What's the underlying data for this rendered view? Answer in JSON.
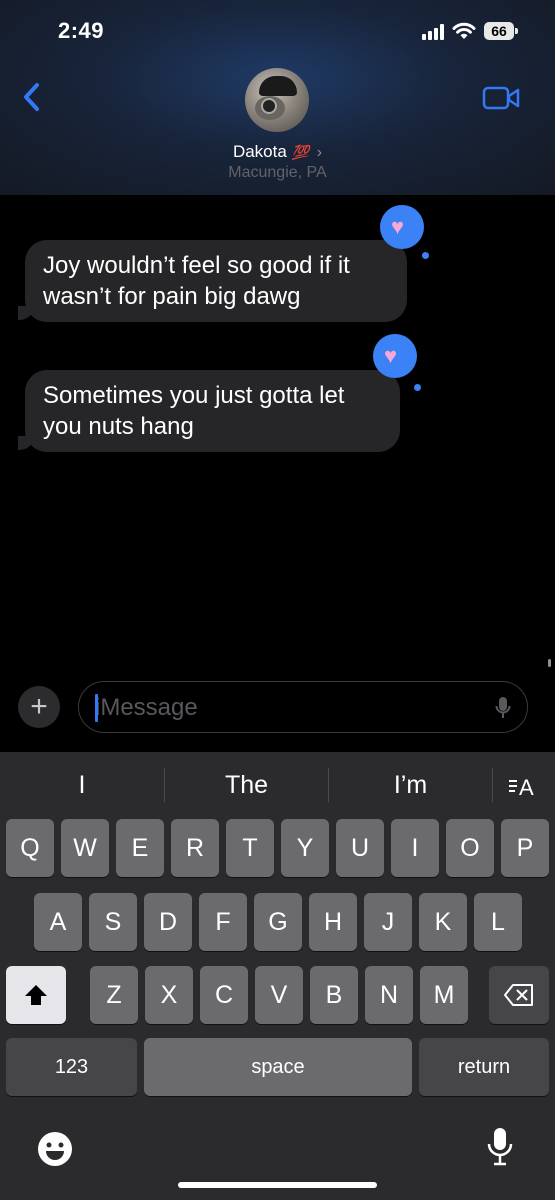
{
  "status": {
    "time": "2:49",
    "battery": "66"
  },
  "contact": {
    "name": "Dakota",
    "emoji": "💯",
    "location": "Macungie, PA"
  },
  "messages": [
    {
      "lines": [
        "Joy wouldn’t feel so good if it",
        "wasn’t for pain big dawg"
      ],
      "tapback": "heart"
    },
    {
      "lines": [
        "Sometimes you just gotta let",
        "you nuts hang"
      ],
      "tapback": "heart"
    }
  ],
  "composer": {
    "placeholder": "iMessage"
  },
  "keyboard": {
    "predictions": [
      "I",
      "The",
      "I’m"
    ],
    "row1": [
      "Q",
      "W",
      "E",
      "R",
      "T",
      "Y",
      "U",
      "I",
      "O",
      "P"
    ],
    "row2": [
      "A",
      "S",
      "D",
      "F",
      "G",
      "H",
      "J",
      "K",
      "L"
    ],
    "row3": [
      "Z",
      "X",
      "C",
      "V",
      "B",
      "N",
      "M"
    ],
    "numbers_label": "123",
    "space_label": "space",
    "return_label": "return"
  },
  "colors": {
    "accent": "#3478f6",
    "bubble": "#262628",
    "tapback": "#3b82f6"
  }
}
